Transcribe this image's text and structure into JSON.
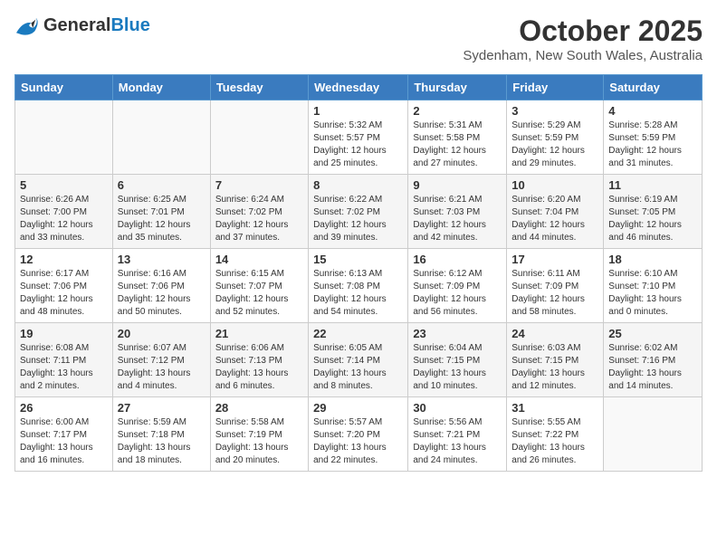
{
  "header": {
    "logo_general": "General",
    "logo_blue": "Blue",
    "month": "October 2025",
    "location": "Sydenham, New South Wales, Australia"
  },
  "weekdays": [
    "Sunday",
    "Monday",
    "Tuesday",
    "Wednesday",
    "Thursday",
    "Friday",
    "Saturday"
  ],
  "weeks": [
    [
      {
        "day": "",
        "sunrise": "",
        "sunset": "",
        "daylight": ""
      },
      {
        "day": "",
        "sunrise": "",
        "sunset": "",
        "daylight": ""
      },
      {
        "day": "",
        "sunrise": "",
        "sunset": "",
        "daylight": ""
      },
      {
        "day": "1",
        "sunrise": "Sunrise: 5:32 AM",
        "sunset": "Sunset: 5:57 PM",
        "daylight": "Daylight: 12 hours and 25 minutes."
      },
      {
        "day": "2",
        "sunrise": "Sunrise: 5:31 AM",
        "sunset": "Sunset: 5:58 PM",
        "daylight": "Daylight: 12 hours and 27 minutes."
      },
      {
        "day": "3",
        "sunrise": "Sunrise: 5:29 AM",
        "sunset": "Sunset: 5:59 PM",
        "daylight": "Daylight: 12 hours and 29 minutes."
      },
      {
        "day": "4",
        "sunrise": "Sunrise: 5:28 AM",
        "sunset": "Sunset: 5:59 PM",
        "daylight": "Daylight: 12 hours and 31 minutes."
      }
    ],
    [
      {
        "day": "5",
        "sunrise": "Sunrise: 6:26 AM",
        "sunset": "Sunset: 7:00 PM",
        "daylight": "Daylight: 12 hours and 33 minutes."
      },
      {
        "day": "6",
        "sunrise": "Sunrise: 6:25 AM",
        "sunset": "Sunset: 7:01 PM",
        "daylight": "Daylight: 12 hours and 35 minutes."
      },
      {
        "day": "7",
        "sunrise": "Sunrise: 6:24 AM",
        "sunset": "Sunset: 7:02 PM",
        "daylight": "Daylight: 12 hours and 37 minutes."
      },
      {
        "day": "8",
        "sunrise": "Sunrise: 6:22 AM",
        "sunset": "Sunset: 7:02 PM",
        "daylight": "Daylight: 12 hours and 39 minutes."
      },
      {
        "day": "9",
        "sunrise": "Sunrise: 6:21 AM",
        "sunset": "Sunset: 7:03 PM",
        "daylight": "Daylight: 12 hours and 42 minutes."
      },
      {
        "day": "10",
        "sunrise": "Sunrise: 6:20 AM",
        "sunset": "Sunset: 7:04 PM",
        "daylight": "Daylight: 12 hours and 44 minutes."
      },
      {
        "day": "11",
        "sunrise": "Sunrise: 6:19 AM",
        "sunset": "Sunset: 7:05 PM",
        "daylight": "Daylight: 12 hours and 46 minutes."
      }
    ],
    [
      {
        "day": "12",
        "sunrise": "Sunrise: 6:17 AM",
        "sunset": "Sunset: 7:06 PM",
        "daylight": "Daylight: 12 hours and 48 minutes."
      },
      {
        "day": "13",
        "sunrise": "Sunrise: 6:16 AM",
        "sunset": "Sunset: 7:06 PM",
        "daylight": "Daylight: 12 hours and 50 minutes."
      },
      {
        "day": "14",
        "sunrise": "Sunrise: 6:15 AM",
        "sunset": "Sunset: 7:07 PM",
        "daylight": "Daylight: 12 hours and 52 minutes."
      },
      {
        "day": "15",
        "sunrise": "Sunrise: 6:13 AM",
        "sunset": "Sunset: 7:08 PM",
        "daylight": "Daylight: 12 hours and 54 minutes."
      },
      {
        "day": "16",
        "sunrise": "Sunrise: 6:12 AM",
        "sunset": "Sunset: 7:09 PM",
        "daylight": "Daylight: 12 hours and 56 minutes."
      },
      {
        "day": "17",
        "sunrise": "Sunrise: 6:11 AM",
        "sunset": "Sunset: 7:09 PM",
        "daylight": "Daylight: 12 hours and 58 minutes."
      },
      {
        "day": "18",
        "sunrise": "Sunrise: 6:10 AM",
        "sunset": "Sunset: 7:10 PM",
        "daylight": "Daylight: 13 hours and 0 minutes."
      }
    ],
    [
      {
        "day": "19",
        "sunrise": "Sunrise: 6:08 AM",
        "sunset": "Sunset: 7:11 PM",
        "daylight": "Daylight: 13 hours and 2 minutes."
      },
      {
        "day": "20",
        "sunrise": "Sunrise: 6:07 AM",
        "sunset": "Sunset: 7:12 PM",
        "daylight": "Daylight: 13 hours and 4 minutes."
      },
      {
        "day": "21",
        "sunrise": "Sunrise: 6:06 AM",
        "sunset": "Sunset: 7:13 PM",
        "daylight": "Daylight: 13 hours and 6 minutes."
      },
      {
        "day": "22",
        "sunrise": "Sunrise: 6:05 AM",
        "sunset": "Sunset: 7:14 PM",
        "daylight": "Daylight: 13 hours and 8 minutes."
      },
      {
        "day": "23",
        "sunrise": "Sunrise: 6:04 AM",
        "sunset": "Sunset: 7:15 PM",
        "daylight": "Daylight: 13 hours and 10 minutes."
      },
      {
        "day": "24",
        "sunrise": "Sunrise: 6:03 AM",
        "sunset": "Sunset: 7:15 PM",
        "daylight": "Daylight: 13 hours and 12 minutes."
      },
      {
        "day": "25",
        "sunrise": "Sunrise: 6:02 AM",
        "sunset": "Sunset: 7:16 PM",
        "daylight": "Daylight: 13 hours and 14 minutes."
      }
    ],
    [
      {
        "day": "26",
        "sunrise": "Sunrise: 6:00 AM",
        "sunset": "Sunset: 7:17 PM",
        "daylight": "Daylight: 13 hours and 16 minutes."
      },
      {
        "day": "27",
        "sunrise": "Sunrise: 5:59 AM",
        "sunset": "Sunset: 7:18 PM",
        "daylight": "Daylight: 13 hours and 18 minutes."
      },
      {
        "day": "28",
        "sunrise": "Sunrise: 5:58 AM",
        "sunset": "Sunset: 7:19 PM",
        "daylight": "Daylight: 13 hours and 20 minutes."
      },
      {
        "day": "29",
        "sunrise": "Sunrise: 5:57 AM",
        "sunset": "Sunset: 7:20 PM",
        "daylight": "Daylight: 13 hours and 22 minutes."
      },
      {
        "day": "30",
        "sunrise": "Sunrise: 5:56 AM",
        "sunset": "Sunset: 7:21 PM",
        "daylight": "Daylight: 13 hours and 24 minutes."
      },
      {
        "day": "31",
        "sunrise": "Sunrise: 5:55 AM",
        "sunset": "Sunset: 7:22 PM",
        "daylight": "Daylight: 13 hours and 26 minutes."
      },
      {
        "day": "",
        "sunrise": "",
        "sunset": "",
        "daylight": ""
      }
    ]
  ]
}
